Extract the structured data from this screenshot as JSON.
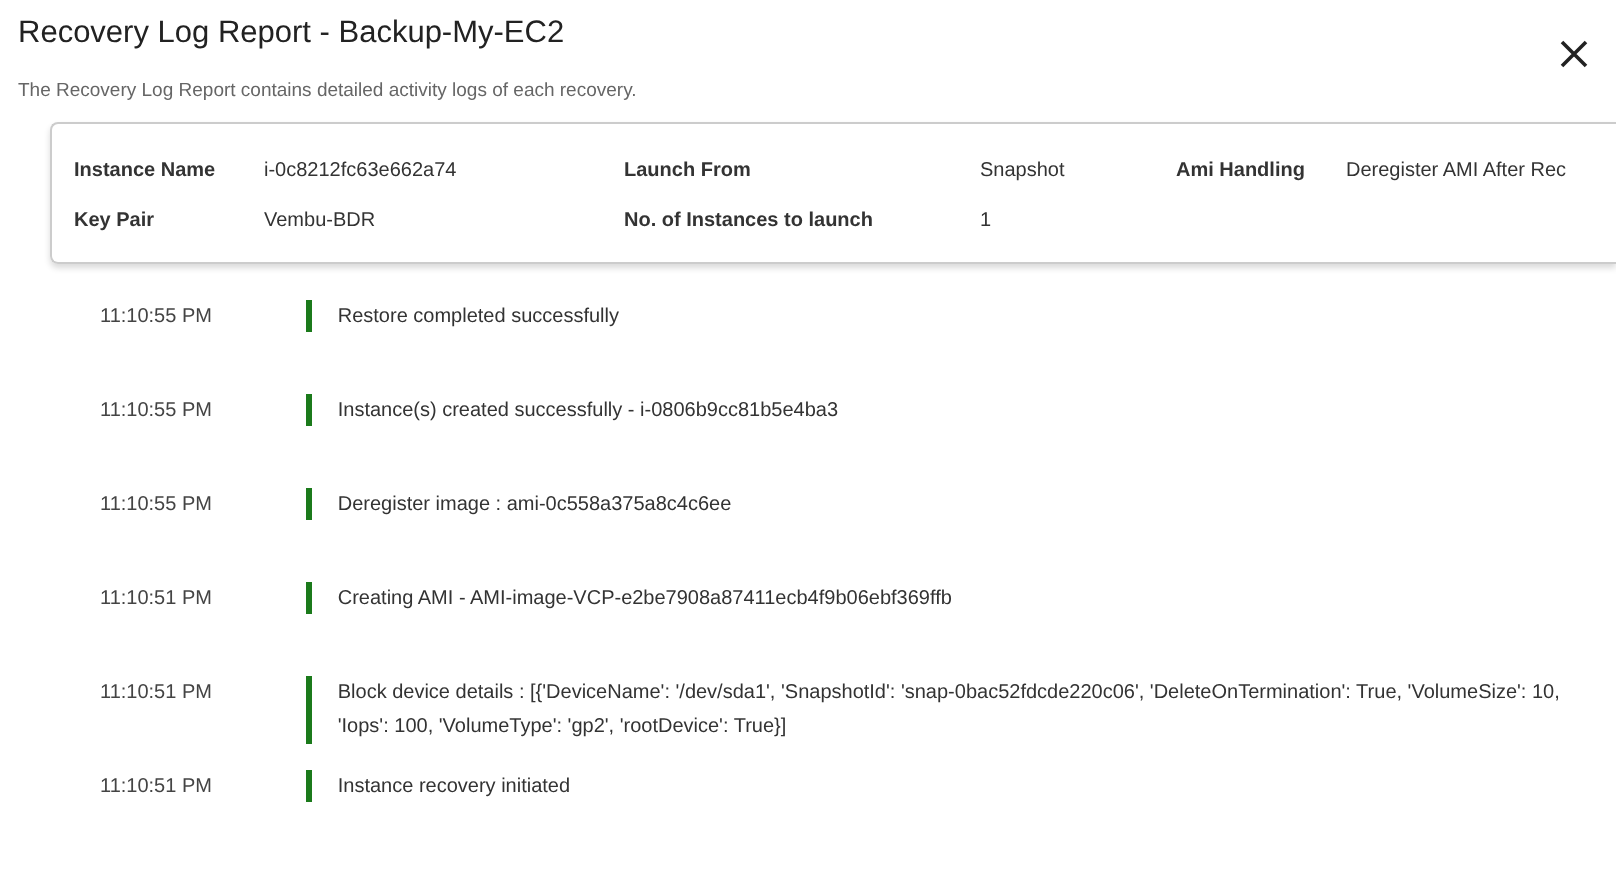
{
  "dialog": {
    "title": "Recovery Log Report - Backup-My-EC2",
    "description": "The Recovery Log Report contains detailed activity logs of each recovery."
  },
  "details": [
    [
      {
        "label": "Instance Name",
        "value": "i-0c8212fc63e662a74"
      },
      {
        "label": "Launch From",
        "value": "Snapshot"
      },
      {
        "label": "Ami Handling",
        "value": "Deregister AMI After Rec"
      }
    ],
    [
      {
        "label": "Key Pair",
        "value": "Vembu-BDR"
      },
      {
        "label": "No. of Instances to launch",
        "value": "1"
      }
    ]
  ],
  "log": [
    {
      "time": "11:10:55 PM",
      "message": "Restore completed successfully"
    },
    {
      "time": "11:10:55 PM",
      "message": "Instance(s) created successfully - i-0806b9cc81b5e4ba3"
    },
    {
      "time": "11:10:55 PM",
      "message": "Deregister image : ami-0c558a375a8c4c6ee"
    },
    {
      "time": "11:10:51 PM",
      "message": "Creating AMI - AMI-image-VCP-e2be7908a87411ecb4f9b06ebf369ffb"
    },
    {
      "time": "11:10:51 PM",
      "message": "Block device details : [{'DeviceName': '/dev/sda1', 'SnapshotId': 'snap-0bac52fdcde220c06', 'DeleteOnTermination': True, 'VolumeSize': 10, 'Iops': 100, 'VolumeType': 'gp2', 'rootDevice': True}]"
    },
    {
      "time": "11:10:51 PM",
      "message": "Instance recovery initiated"
    }
  ]
}
